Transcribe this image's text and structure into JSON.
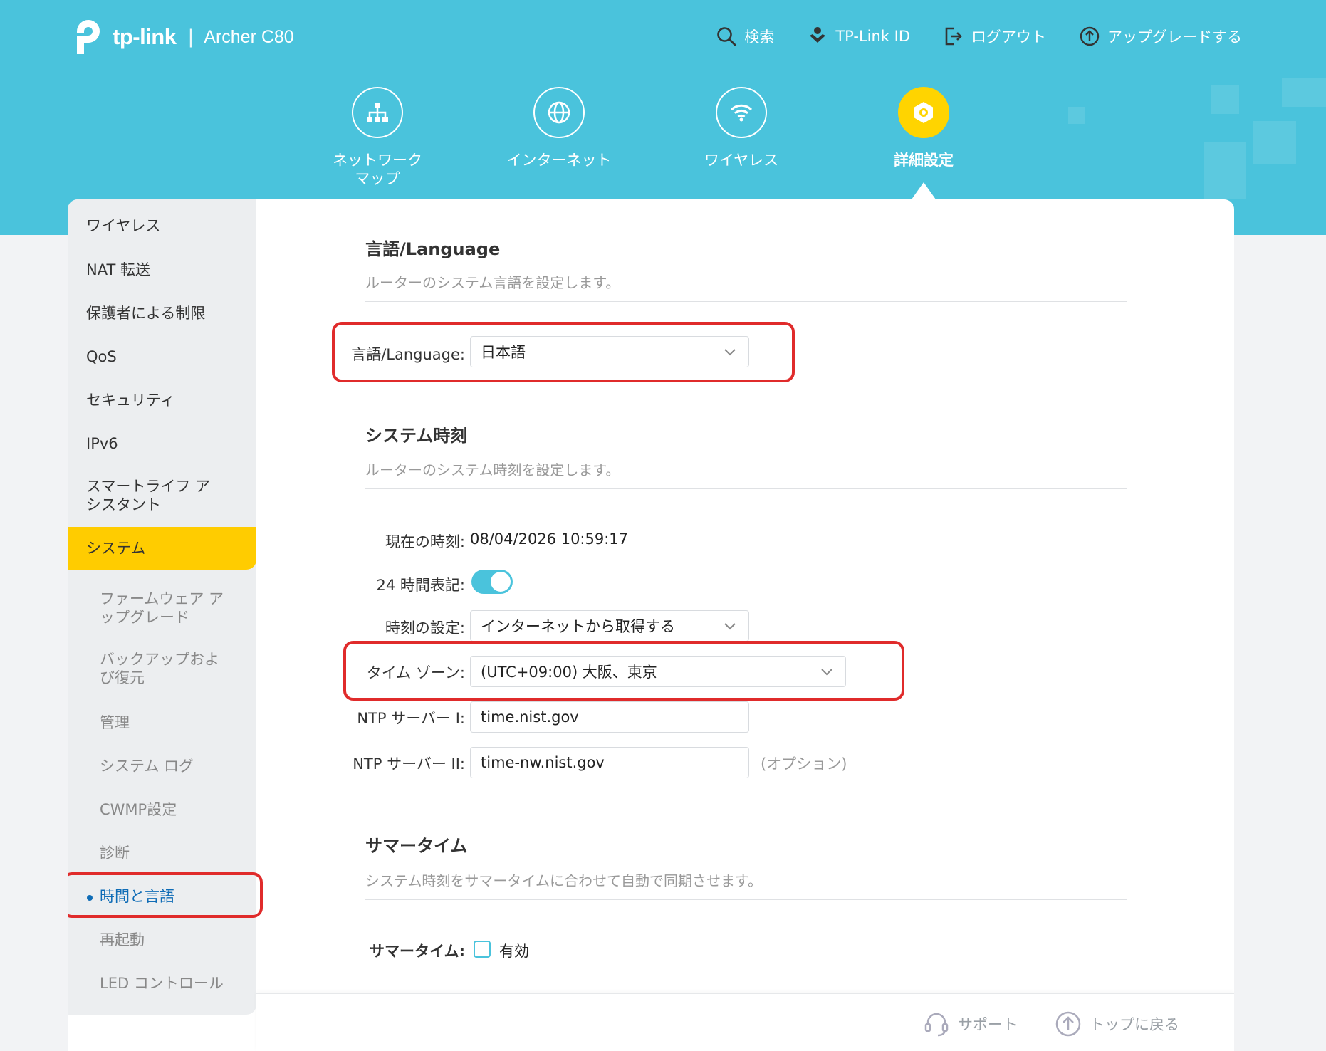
{
  "brand": {
    "logo_text": "tp-link",
    "separator": "|",
    "model": "Archer C80"
  },
  "topnav": [
    {
      "label": "検索",
      "icon": "search-icon"
    },
    {
      "label": "TP-Link ID",
      "icon": "tplink-id-icon"
    },
    {
      "label": "ログアウト",
      "icon": "logout-icon"
    },
    {
      "label": "アップグレードする",
      "icon": "upgrade-icon"
    }
  ],
  "mainnav": [
    {
      "label": "ネットワーク\nマップ",
      "icon": "network-map-icon",
      "active": false
    },
    {
      "label": "インターネット",
      "icon": "internet-icon",
      "active": false
    },
    {
      "label": "ワイヤレス",
      "icon": "wireless-icon",
      "active": false
    },
    {
      "label": "詳細設定",
      "icon": "advanced-gear-icon",
      "active": true
    }
  ],
  "sidebar": {
    "items": [
      {
        "label": "ワイヤレス"
      },
      {
        "label": "NAT 転送"
      },
      {
        "label": "保護者による制限"
      },
      {
        "label": "QoS"
      },
      {
        "label": "セキュリティ"
      },
      {
        "label": "IPv6"
      },
      {
        "label": "スマートライフ ア\nシスタント"
      },
      {
        "label": "システム",
        "active": true
      }
    ],
    "subitems": [
      {
        "label": "ファームウェア ア\nップグレード"
      },
      {
        "label": "バックアップおよ\nび復元"
      },
      {
        "label": "管理"
      },
      {
        "label": "システム ログ"
      },
      {
        "label": "CWMP設定"
      },
      {
        "label": "診断"
      },
      {
        "label": "時間と言語",
        "active": true
      },
      {
        "label": "再起動"
      },
      {
        "label": "LED コントロール"
      }
    ]
  },
  "language": {
    "title": "言語/Language",
    "desc": "ルーターのシステム言語を設定します。",
    "field_label": "言語/Language:",
    "value": "日本語"
  },
  "system_time": {
    "title": "システム時刻",
    "desc": "ルーターのシステム時刻を設定します。",
    "current_label": "現在の時刻:",
    "current_value": "08/04/2026 10:59:17",
    "format24_label": "24 時間表記:",
    "format24_on": true,
    "set_label": "時刻の設定:",
    "set_value": "インターネットから取得する",
    "tz_label": "タイム ゾーン:",
    "tz_value": "(UTC+09:00) 大阪、東京",
    "ntp1_label": "NTP サーバー I:",
    "ntp1_value": "time.nist.gov",
    "ntp2_label": "NTP サーバー II:",
    "ntp2_value": "time-nw.nist.gov",
    "optional": "(オプション)"
  },
  "dst": {
    "title": "サマータイム",
    "desc": "システム時刻をサマータイムに合わせて自動で同期させます。",
    "label": "サマータイム:",
    "checkbox_label": "有効",
    "enabled": false
  },
  "footer": {
    "support": "サポート",
    "back_to_top": "トップに戻る"
  },
  "colors": {
    "header": "#4ac3dc",
    "active": "#ffcc00",
    "highlight": "#e02b2b",
    "link": "#0f6cb6"
  }
}
